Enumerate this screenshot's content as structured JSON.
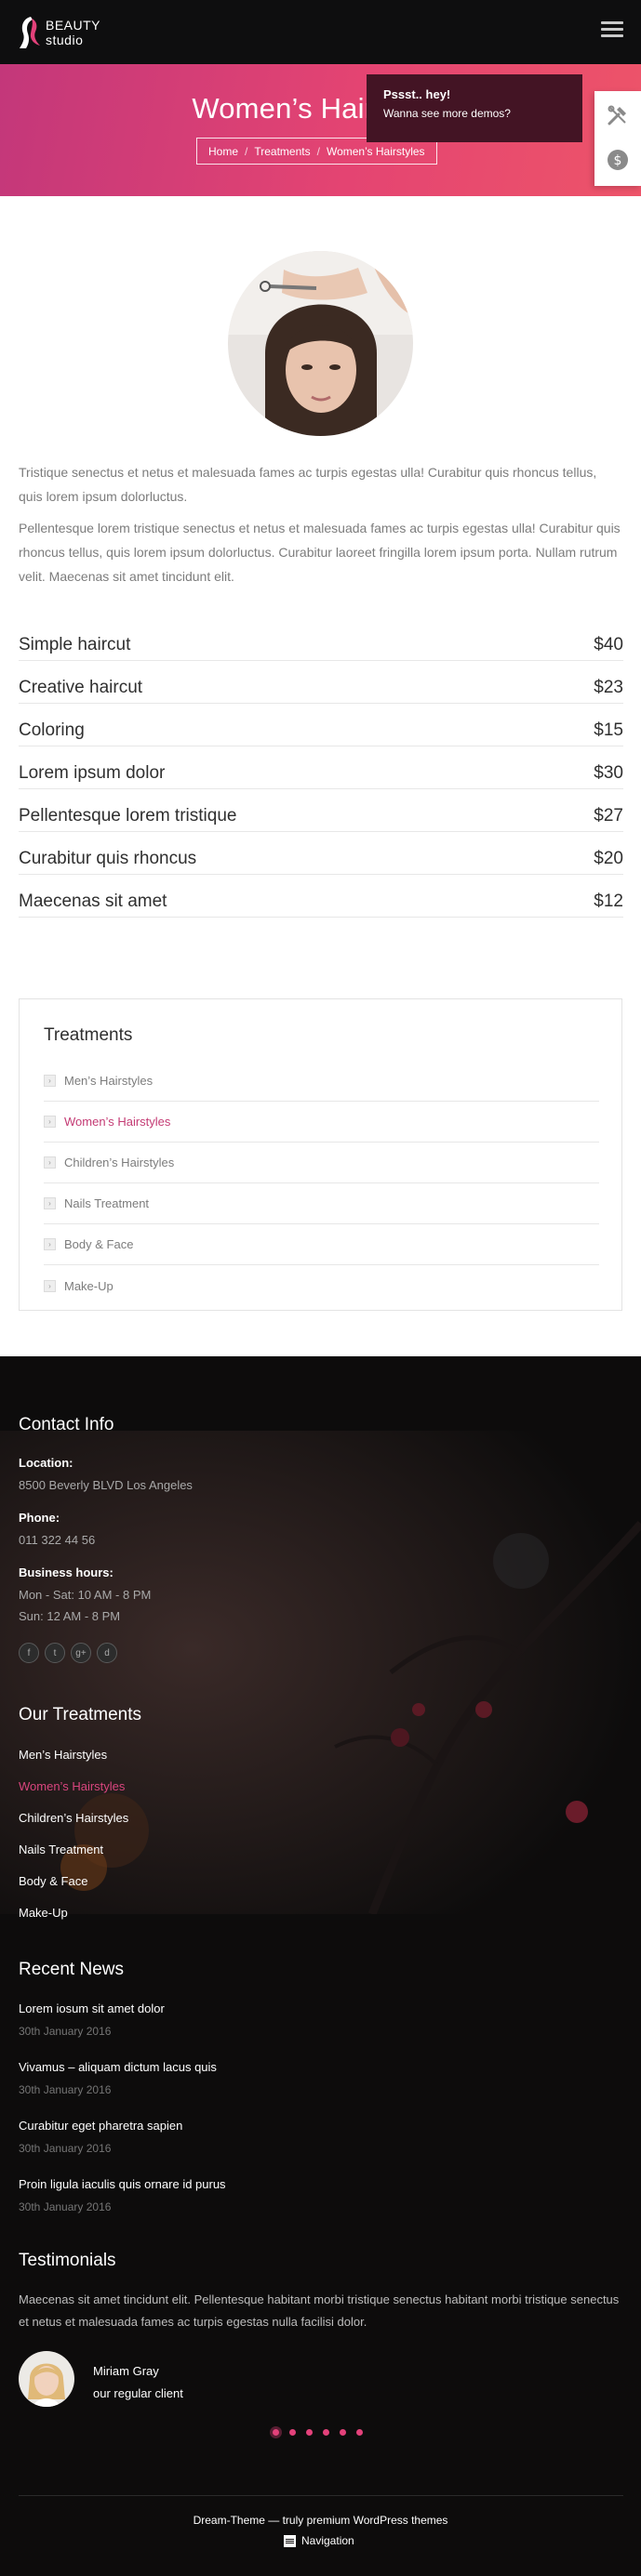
{
  "header": {
    "logo_line1": "BEAUTY",
    "logo_line2": "studio",
    "menu_icon": "hamburger-icon"
  },
  "hero": {
    "title": "Women’s Hairstyles",
    "breadcrumb": [
      "Home",
      "Treatments",
      "Women’s Hairstyles"
    ],
    "separator": "/"
  },
  "popup": {
    "heading": "Pssst.. hey!",
    "text": "Wanna see more demos?"
  },
  "side_tools": [
    "tools-icon",
    "dollar-icon"
  ],
  "colors": {
    "accent": "#e3417a",
    "hero_start": "#c3377a",
    "hero_end": "#ed5469",
    "footer_bg": "#0d0c0c"
  },
  "intro": {
    "paragraph1": "Tristique senectus et netus et malesuada fames ac turpis egestas ulla! Curabitur quis rhoncus tellus, quis lorem ipsum dolorluctus.",
    "paragraph2": "Pellentesque lorem tristique senectus et netus et malesuada fames ac turpis egestas ulla! Curabitur quis rhoncus tellus, quis lorem ipsum dolorluctus. Curabitur laoreet fringilla lorem ipsum porta. Nullam rutrum velit. Maecenas sit amet tincidunt elit."
  },
  "prices": [
    {
      "name": "Simple haircut",
      "price": "$40"
    },
    {
      "name": "Creative haircut",
      "price": "$23"
    },
    {
      "name": "Coloring",
      "price": "$15"
    },
    {
      "name": "Lorem ipsum dolor",
      "price": "$30"
    },
    {
      "name": "Pellentesque lorem tristique",
      "price": "$27"
    },
    {
      "name": "Curabitur quis rhoncus",
      "price": "$20"
    },
    {
      "name": "Maecenas sit amet",
      "price": "$12"
    }
  ],
  "treatments_widget": {
    "title": "Treatments",
    "items": [
      "Men’s Hairstyles",
      "Women’s Hairstyles",
      "Children’s Hairstyles",
      "Nails Treatment",
      "Body & Face",
      "Make-Up"
    ],
    "active_index": 1
  },
  "contact": {
    "title": "Contact Info",
    "location_label": "Location:",
    "location": "8500 Beverly BLVD Los Angeles",
    "phone_label": "Phone:",
    "phone": "011 322 44 56",
    "hours_label": "Business hours:",
    "hours1": "Mon - Sat: 10 AM - 8 PM",
    "hours2": "Sun: 12 AM - 8 PM",
    "social": [
      "f",
      "t",
      "g+",
      "d"
    ]
  },
  "our_treatments": {
    "title": "Our Treatments",
    "items": [
      "Men’s Hairstyles",
      "Women’s Hairstyles",
      "Children’s Hairstyles",
      "Nails Treatment",
      "Body & Face",
      "Make-Up"
    ]
  },
  "recent_news": {
    "title": "Recent News",
    "items": [
      {
        "title": "Lorem iosum sit amet dolor",
        "date": "30th January 2016"
      },
      {
        "title": "Vivamus – aliquam dictum lacus quis",
        "date": "30th January 2016"
      },
      {
        "title": "Curabitur eget pharetra sapien",
        "date": "30th January 2016"
      },
      {
        "title": "Proin ligula iaculis quis ornare id purus",
        "date": "30th January 2016"
      }
    ]
  },
  "testimonials": {
    "title": "Testimonials",
    "text": "Maecenas sit amet tincidunt elit. Pellentesque habitant morbi tristique senectus habitant morbi tristique senectus et netus et malesuada fames ac turpis egestas nulla facilisi dolor.",
    "name": "Miriam Gray",
    "role": "our regular client",
    "slides": 6,
    "active_slide": 1
  },
  "footer": {
    "copyright": "Dream-Theme — truly premium WordPress themes",
    "nav_label": "Navigation"
  }
}
